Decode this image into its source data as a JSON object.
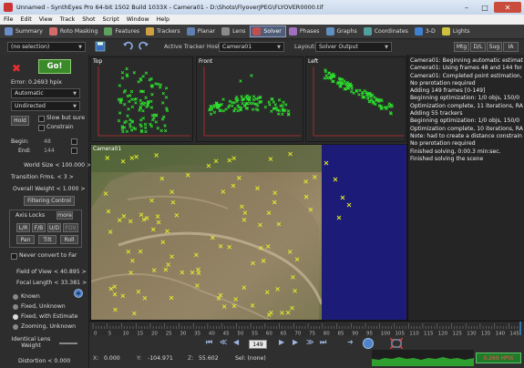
{
  "window": {
    "title": "Unnamed - SynthEyes Pro 64-bit 1502 Build 1033X - Camera01 - D:\\Shots\\FlyoverJPEG\\FLYOVER0000.tif",
    "minimize": "–",
    "maximize": "□",
    "close": "✕"
  },
  "menu": [
    "File",
    "Edit",
    "View",
    "Track",
    "Shot",
    "Script",
    "Window",
    "Help"
  ],
  "rooms": [
    {
      "label": "Summary",
      "color": "#6a8cc8"
    },
    {
      "label": "Roto Masking",
      "color": "#d46a6a"
    },
    {
      "label": "Features",
      "color": "#5fa05f"
    },
    {
      "label": "Trackers",
      "color": "#d0a040"
    },
    {
      "label": "Planar",
      "color": "#5f7fb0"
    },
    {
      "label": "Lens",
      "color": "#8a8a8a"
    },
    {
      "label": "Solver",
      "color": "#c05050"
    },
    {
      "label": "Phases",
      "color": "#a070c0"
    },
    {
      "label": "Graphs",
      "color": "#6090c0"
    },
    {
      "label": "Coordinates",
      "color": "#50a0a0"
    },
    {
      "label": "3-D",
      "color": "#4080d0"
    },
    {
      "label": "Lights",
      "color": "#d0c040"
    }
  ],
  "active_room": "Solver",
  "toolbar": {
    "selection": "(no selection)",
    "tracker_host_label": "Active Tracker Host:",
    "tracker_host": "Camera01",
    "layout_label": "Layout:",
    "layout": "Solver Output",
    "mtg": "Mtg",
    "dl": "D/L",
    "sug": "Sug",
    "ia": "IA"
  },
  "left": {
    "go": "Go!",
    "error": "Error:  0.2693 hpix",
    "mode": "Automatic",
    "direction": "Undirected",
    "hold": "Hold",
    "slow_but_sure": "Slow but sure",
    "constrain": "Constrain",
    "begin_label": "Begin:",
    "begin_value": "48",
    "end_label": "End:",
    "end_value": "144",
    "world_size": "World Size < 100.000 >",
    "transition_frms": "Transition Frms. < 3 >",
    "overall_weight": "Overall Weight < 1.000 >",
    "filtering_control": "Filtering Control",
    "axis_locks": "Axis Locks",
    "more": "more",
    "lr": "L/R",
    "fb": "F/B",
    "ud": "U/D",
    "fov": "FOV",
    "pan": "Pan",
    "tilt": "Tilt",
    "roll": "Roll",
    "never_convert": "Never convert to Far",
    "fov_value": "Field of View < 40.895 >",
    "focal_length": "Focal Length < 33.381 >",
    "lens_modes": [
      "Known",
      "Fixed, Unknown",
      "Fixed, with Estimate",
      "Zooming, Unknown"
    ],
    "identical_lens_weight": "Identical Lens Weight",
    "distortion": "Distortion < 0.000"
  },
  "viewports": {
    "top": "Top",
    "front": "Front",
    "left": "Left",
    "camera": "Camera01"
  },
  "log": [
    "Camera01: Beginning automatic estimat",
    "Camera01: Using frames 48 and 144 for i",
    "Camera01: Completed point estimation,",
    "No prerotation required",
    "Adding 149 frames [0-149]",
    "Beginning optimization: 1/0 objs, 150/0",
    "Optimization complete, 11 iterations, RA",
    "Adding 55 trackers",
    "Beginning optimization: 1/0 objs, 150/0",
    "Optimization complete, 10 iterations, RA",
    "Note: had to create a distance constrain",
    "No prerotation required",
    "Finished solving, 0:00.3 min:sec.",
    "Finished solving the scene"
  ],
  "timeline": {
    "ticks": [
      "0",
      "5",
      "10",
      "15",
      "20",
      "25",
      "30",
      "35",
      "40",
      "45",
      "50",
      "55",
      "60",
      "65",
      "70",
      "75",
      "80",
      "85",
      "90",
      "95",
      "100",
      "105",
      "110",
      "115",
      "120",
      "125",
      "130",
      "135",
      "140",
      "145"
    ],
    "current_frame": 149
  },
  "status": {
    "x_label": "X:",
    "x_value": "0.000",
    "y_label": "Y:",
    "y_value": "-104.971",
    "z_label": "Z:",
    "z_value": "55.602",
    "sel": "Sel: (none)",
    "frame": "149",
    "hpix": "0.269 HPIX"
  },
  "colors": {
    "go": "#3a8a2a",
    "tracker": "#e6f026",
    "points": "#2ee02e",
    "accent": "#3a4ea0"
  }
}
